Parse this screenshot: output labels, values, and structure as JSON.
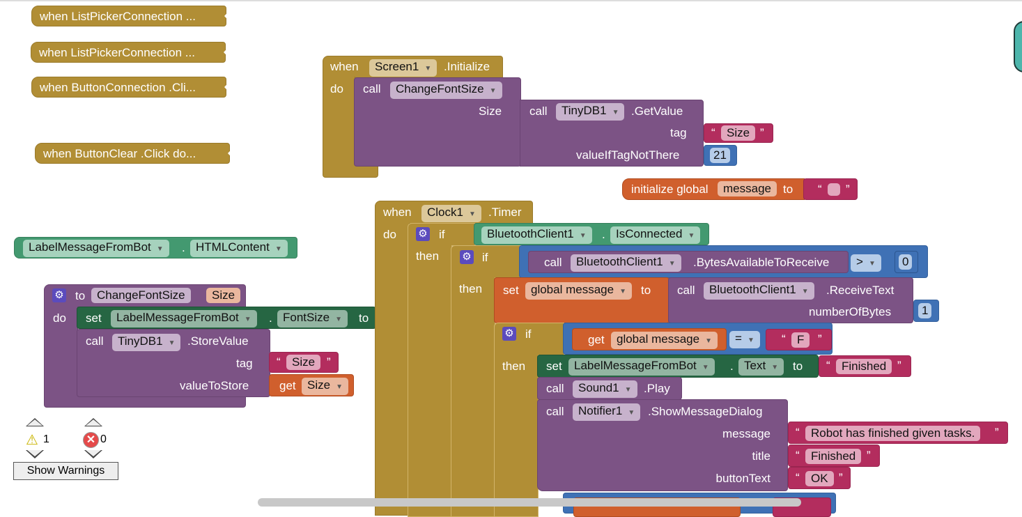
{
  "colors": {
    "event": "#b18e35",
    "procedure": "#7c5385",
    "text": "#b32d5e",
    "math": "#3f71b5",
    "variable": "#d05f2d",
    "component": "#439970",
    "setter": "#266643",
    "mutator": "#5b4bbd"
  },
  "collapsed": [
    "when  ListPickerConnection ...",
    "when  ListPickerConnection ...",
    "when  ButtonConnection .Cli...",
    "when  ButtonClear .Click do..."
  ],
  "init": {
    "when": "when",
    "component": "Screen1",
    "event": ".Initialize",
    "do": "do",
    "call": "call",
    "proc": "ChangeFontSize",
    "size": "Size",
    "call2": "call",
    "db": "TinyDB1",
    "method": ".GetValue",
    "tag": "tag",
    "tag_val": "Size",
    "default": "valueIfTagNotThere",
    "default_val": "21"
  },
  "global": {
    "label": "initialize global",
    "name": "message",
    "to": "to",
    "value": ""
  },
  "html_getter": {
    "component": "LabelMessageFromBot",
    "property": "HTMLContent",
    "dot": "."
  },
  "proc": {
    "to": "to",
    "name": "ChangeFontSize",
    "param": "Size",
    "do": "do",
    "set": "set",
    "comp": "LabelMessageFromBot",
    "dot": ".",
    "prop": "FontSize",
    "to2": "to",
    "call": "call",
    "db": "TinyDB1",
    "method": ".StoreValue",
    "tag": "tag",
    "tag_val": "Size",
    "vts": "valueToStore",
    "get": "get",
    "get_val": "Size"
  },
  "timer": {
    "when": "when",
    "component": "Clock1",
    "event": ".Timer",
    "do": "do",
    "if1": "if",
    "then1": "then",
    "bt": "BluetoothClient1",
    "dot": ".",
    "prop": "IsConnected",
    "if2": "if",
    "then2": "then",
    "call": "call",
    "bt2": "BluetoothClient1",
    "bytes": ".BytesAvailableToReceive",
    "op": ">",
    "zero": "0",
    "set": "set",
    "gm": "global message",
    "to": "to",
    "call2": "call",
    "bt3": "BluetoothClient1",
    "recv": ".ReceiveText",
    "nob": "numberOfBytes",
    "one": "1",
    "if3": "if",
    "then3": "then",
    "get": "get",
    "gm2": "global message",
    "eq": "=",
    "F": "F",
    "set2": "set",
    "lbl": "LabelMessageFromBot",
    "dot2": ".",
    "txt": "Text",
    "to2": "to",
    "finished": "Finished",
    "call3": "call",
    "sound": "Sound1",
    "play": ".Play",
    "call4": "call",
    "notifier": "Notifier1",
    "show": ".ShowMessageDialog",
    "message": "message",
    "msg_val": "Robot has finished given tasks.",
    "title": "title",
    "title_val": "Finished",
    "buttonText": "buttonText",
    "ok": "OK"
  },
  "warnings": {
    "warn_count": "1",
    "error_count": "0",
    "button": "Show Warnings"
  }
}
